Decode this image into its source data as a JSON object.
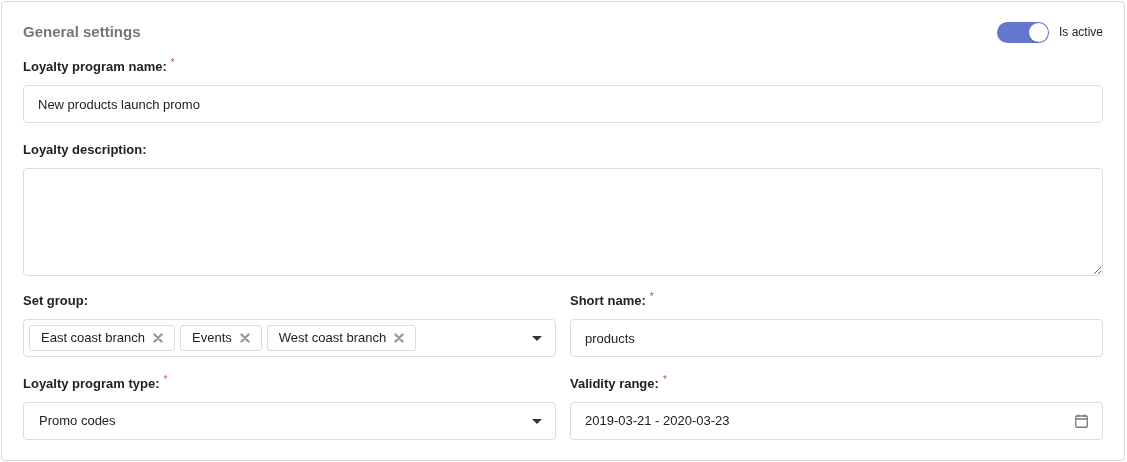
{
  "section": {
    "title": "General settings",
    "toggle": {
      "label": "Is active",
      "on": true
    }
  },
  "name_field": {
    "label": "Loyalty program name:",
    "required_mark": "*",
    "value": "New products launch promo"
  },
  "description_field": {
    "label": "Loyalty description:"
  },
  "group_field": {
    "label": "Set group:",
    "tags": [
      "East coast branch",
      "Events",
      "West coast branch"
    ]
  },
  "short_name_field": {
    "label": "Short name:",
    "required_mark": "*",
    "value": "products"
  },
  "type_field": {
    "label": "Loyalty program type:",
    "required_mark": "*",
    "value": "Promo codes"
  },
  "validity_field": {
    "label": "Validity range:",
    "required_mark": "*",
    "value": "2019-03-21 - 2020-03-23"
  }
}
